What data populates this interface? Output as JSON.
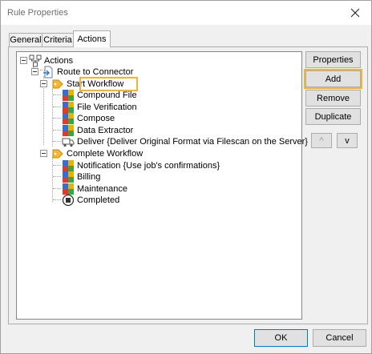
{
  "window": {
    "title": "Rule Properties",
    "close_glyph": "✕"
  },
  "tabs": [
    {
      "label": "General"
    },
    {
      "label": "Criteria"
    },
    {
      "label": "Actions"
    }
  ],
  "tree": {
    "root": "Actions",
    "route": "Route to Connector",
    "start_workflow": "Start Workflow",
    "start_items": [
      "Compound File",
      "File Verification",
      "Compose",
      "Data Extractor",
      "Deliver {Deliver Original Format via Filescan on the Server}"
    ],
    "complete_workflow": "Complete Workflow",
    "complete_items": [
      "Notification {Use job's confirmations}",
      "Billing",
      "Maintenance",
      "Completed"
    ]
  },
  "buttons": {
    "properties": "Properties",
    "add": "Add",
    "remove": "Remove",
    "duplicate": "Duplicate",
    "up": "^",
    "down": "v",
    "ok": "OK",
    "cancel": "Cancel"
  },
  "colors": {
    "highlight": "#f2b530",
    "accent": "#0078d7"
  }
}
